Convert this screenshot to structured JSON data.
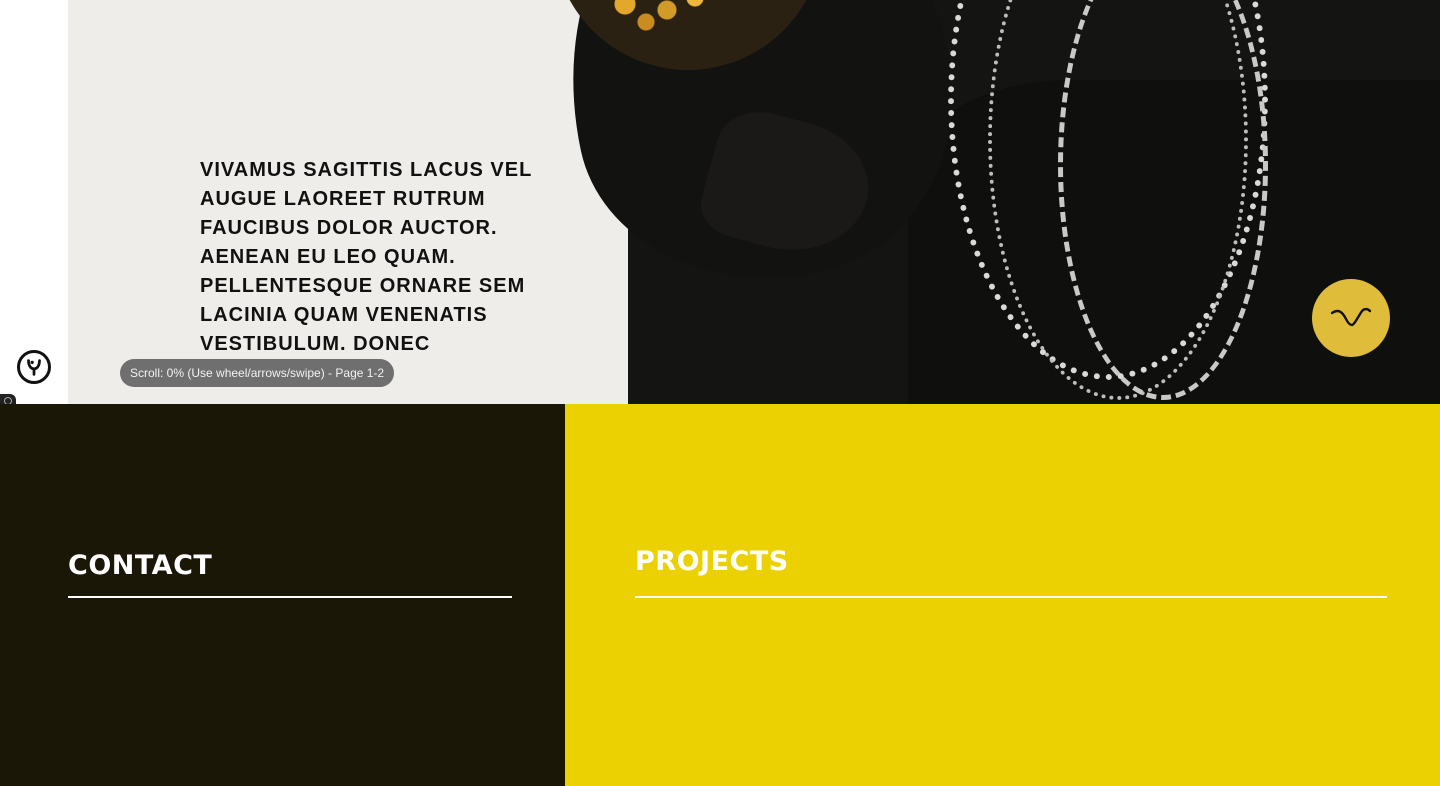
{
  "hero": {
    "text": "VIVAMUS SAGITTIS LACUS VEL AUGUE LAOREET RUTRUM FAUCIBUS DOLOR AUCTOR. AENEAN EU LEO QUAM. PELLENTESQUE ORNARE SEM LACINIA QUAM VENENATIS VESTIBULUM. DONEC",
    "scroll_indicator": "Scroll: 0% (Use wheel/arrows/swipe) - Page 1-2",
    "down_button_icon": "wave-chevron-icon"
  },
  "sidebar": {
    "logo_icon": "brand-logo-icon"
  },
  "sections": {
    "contact_title": "CONTACT",
    "projects_title": "PROJECTS"
  },
  "colors": {
    "accent_yellow": "#EBD101",
    "button_gold": "#DFBD3A",
    "dark_panel": "#1B1707",
    "text_dark": "#111111",
    "white": "#FFFFFF"
  }
}
